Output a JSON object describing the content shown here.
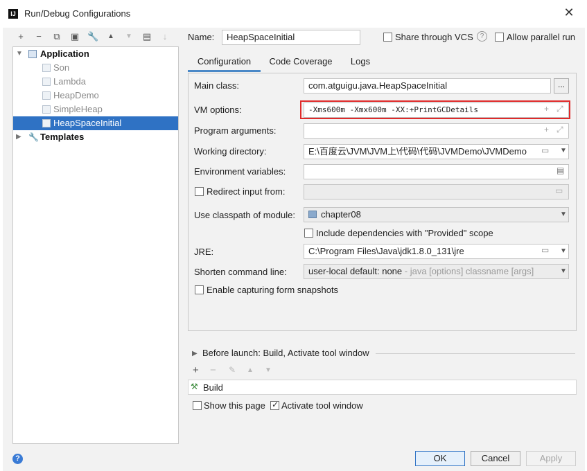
{
  "window": {
    "title": "Run/Debug Configurations",
    "app_icon": "IJ"
  },
  "toolbar": {
    "icons": [
      {
        "name": "add-icon",
        "glyph": "+"
      },
      {
        "name": "remove-icon",
        "glyph": "−"
      },
      {
        "name": "copy-icon",
        "glyph": "⧉"
      },
      {
        "name": "save-icon",
        "glyph": "▣"
      },
      {
        "name": "wrench-icon",
        "glyph": "🔧"
      },
      {
        "name": "move-up-icon",
        "glyph": "▲"
      },
      {
        "name": "move-down-icon",
        "glyph": "▼"
      },
      {
        "name": "folder-icon",
        "glyph": "▤"
      },
      {
        "name": "sort-icon",
        "glyph": "↓"
      }
    ]
  },
  "tree": {
    "groups": [
      {
        "label": "Application",
        "children": [
          "Son",
          "Lambda",
          "HeapDemo",
          "SimpleHeap",
          "HeapSpaceInitial"
        ]
      },
      {
        "label": "Templates"
      }
    ],
    "selected": "HeapSpaceInitial"
  },
  "header": {
    "name_label": "Name:",
    "name_value": "HeapSpaceInitial",
    "share_label": "Share through VCS",
    "allow_parallel_label": "Allow parallel run"
  },
  "tabs": [
    "Configuration",
    "Code Coverage",
    "Logs"
  ],
  "config": {
    "main_class_label": "Main class:",
    "main_class_value": "com.atguigu.java.HeapSpaceInitial",
    "vm_options_label": "VM options:",
    "vm_options_value": "-Xms600m -Xmx600m -XX:+PrintGCDetails",
    "program_args_label": "Program arguments:",
    "program_args_value": "",
    "working_dir_label": "Working directory:",
    "working_dir_value": "E:\\百度云\\JVM\\JVM上\\代码\\代码\\JVMDemo\\JVMDemo",
    "env_vars_label": "Environment variables:",
    "env_vars_value": "",
    "redirect_label": "Redirect input from:",
    "classpath_label": "Use classpath of module:",
    "classpath_value": "chapter08",
    "include_deps_label": "Include dependencies with \"Provided\" scope",
    "jre_label": "JRE:",
    "jre_value": "C:\\Program Files\\Java\\jdk1.8.0_131\\jre",
    "shorten_label": "Shorten command line:",
    "shorten_value": "user-local default: none",
    "shorten_hint": " - java [options] classname [args]",
    "snapshots_label": "Enable capturing form snapshots"
  },
  "before_launch": {
    "title": "Before launch: Build, Activate tool window",
    "items": [
      "Build"
    ],
    "show_page_label": "Show this page",
    "activate_label": "Activate tool window"
  },
  "buttons": {
    "ok": "OK",
    "cancel": "Cancel",
    "apply": "Apply"
  },
  "help": {
    "glyph": "?"
  },
  "colors": {
    "selection": "#2f72c4",
    "highlight_box": "#e02a2a",
    "tab_underline": "#4a88c7"
  }
}
